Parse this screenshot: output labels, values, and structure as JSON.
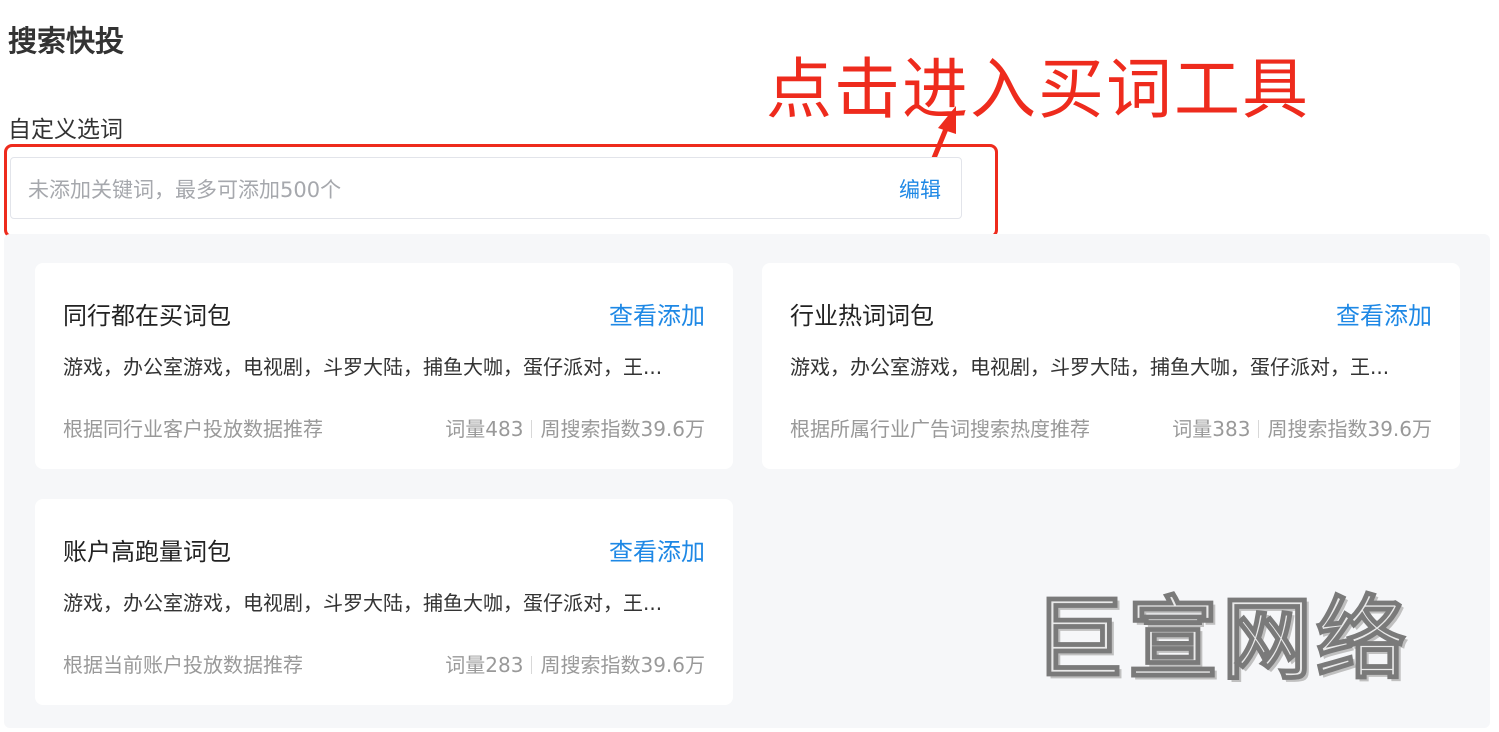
{
  "page": {
    "title": "搜索快投"
  },
  "annotation": {
    "text": "点击进入买词工具",
    "color": "#ee2b1d"
  },
  "custom_keywords": {
    "label": "自定义选词",
    "placeholder": "未添加关键词，最多可添加500个",
    "edit_label": "编辑"
  },
  "packages": [
    {
      "title": "同行都在买词包",
      "action_label": "查看添加",
      "keywords": "游戏，办公室游戏，电视剧，斗罗大陆，捕鱼大咖，蛋仔派对，王...",
      "description": "根据同行业客户投放数据推荐",
      "word_count": "词量483",
      "weekly_index": "周搜索指数39.6万"
    },
    {
      "title": "行业热词词包",
      "action_label": "查看添加",
      "keywords": "游戏，办公室游戏，电视剧，斗罗大陆，捕鱼大咖，蛋仔派对，王...",
      "description": "根据所属行业广告词搜索热度推荐",
      "word_count": "词量383",
      "weekly_index": "周搜索指数39.6万"
    },
    {
      "title": "账户高跑量词包",
      "action_label": "查看添加",
      "keywords": "游戏，办公室游戏，电视剧，斗罗大陆，捕鱼大咖，蛋仔派对，王...",
      "description": "根据当前账户投放数据推荐",
      "word_count": "词量283",
      "weekly_index": "周搜索指数39.6万"
    }
  ],
  "watermark": {
    "text": "巨宣网络"
  },
  "colors": {
    "link": "#1e88e5",
    "panel_bg": "#f6f7f9"
  }
}
